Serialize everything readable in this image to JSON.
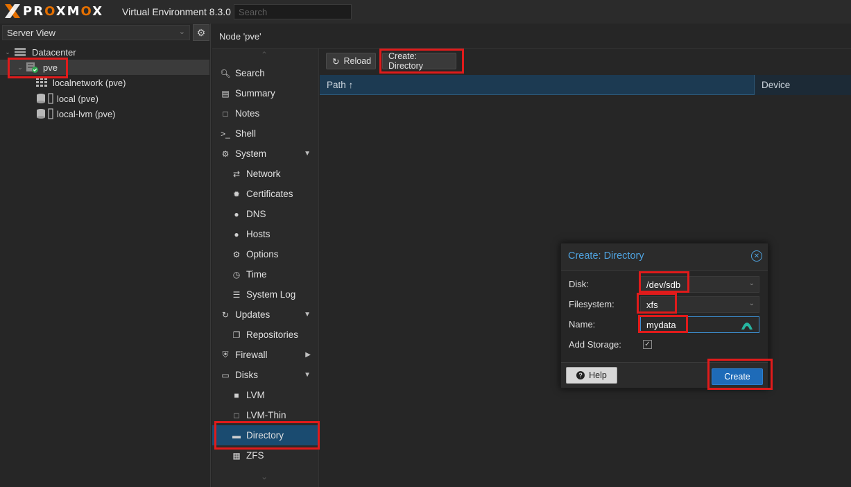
{
  "header": {
    "brand_prefix": "PR",
    "brand_o1": "O",
    "brand_mid": "XM",
    "brand_o2": "O",
    "brand_suffix": "X",
    "title": "Virtual Environment 8.3.0",
    "search_placeholder": "Search"
  },
  "tree": {
    "view": "Server View",
    "items": [
      {
        "label": "Datacenter"
      },
      {
        "label": "pve"
      },
      {
        "label": "localnetwork (pve)"
      },
      {
        "label": "local (pve)"
      },
      {
        "label": "local-lvm (pve)"
      }
    ]
  },
  "node": {
    "title": "Node 'pve'"
  },
  "nav": {
    "items": [
      {
        "label": "Search",
        "icon": "search-icon"
      },
      {
        "label": "Summary",
        "icon": "book-icon"
      },
      {
        "label": "Notes",
        "icon": "note-icon"
      },
      {
        "label": "Shell",
        "icon": "terminal-icon"
      },
      {
        "label": "System",
        "icon": "cogs-icon"
      },
      {
        "label": "Network",
        "icon": "exchange-icon"
      },
      {
        "label": "Certificates",
        "icon": "certificate-icon"
      },
      {
        "label": "DNS",
        "icon": "globe-icon"
      },
      {
        "label": "Hosts",
        "icon": "globe-icon"
      },
      {
        "label": "Options",
        "icon": "gear-icon"
      },
      {
        "label": "Time",
        "icon": "clock-icon"
      },
      {
        "label": "System Log",
        "icon": "list-icon"
      },
      {
        "label": "Updates",
        "icon": "refresh-icon"
      },
      {
        "label": "Repositories",
        "icon": "files-icon"
      },
      {
        "label": "Firewall",
        "icon": "shield-icon"
      },
      {
        "label": "Disks",
        "icon": "hdd-icon"
      },
      {
        "label": "LVM",
        "icon": "square-icon"
      },
      {
        "label": "LVM-Thin",
        "icon": "square-outline-icon"
      },
      {
        "label": "Directory",
        "icon": "folder-icon"
      },
      {
        "label": "ZFS",
        "icon": "th-large-icon"
      }
    ]
  },
  "toolbar": {
    "reload": "Reload",
    "create_directory": "Create: Directory"
  },
  "grid": {
    "columns": [
      "Path ↑",
      "Device"
    ]
  },
  "dialog": {
    "title": "Create: Directory",
    "fields": {
      "disk_label": "Disk:",
      "disk_value": "/dev/sdb",
      "filesystem_label": "Filesystem:",
      "filesystem_value": "xfs",
      "name_label": "Name:",
      "name_value": "mydata",
      "add_storage_label": "Add Storage:",
      "add_storage_checked": true
    },
    "help": "Help",
    "create": "Create"
  },
  "colors": {
    "accent": "#1a4b70",
    "title_blue": "#4fa3e0",
    "create_button": "#1e6bb8",
    "brand_orange": "#e57000",
    "annotation_red": "#e01b1b"
  }
}
